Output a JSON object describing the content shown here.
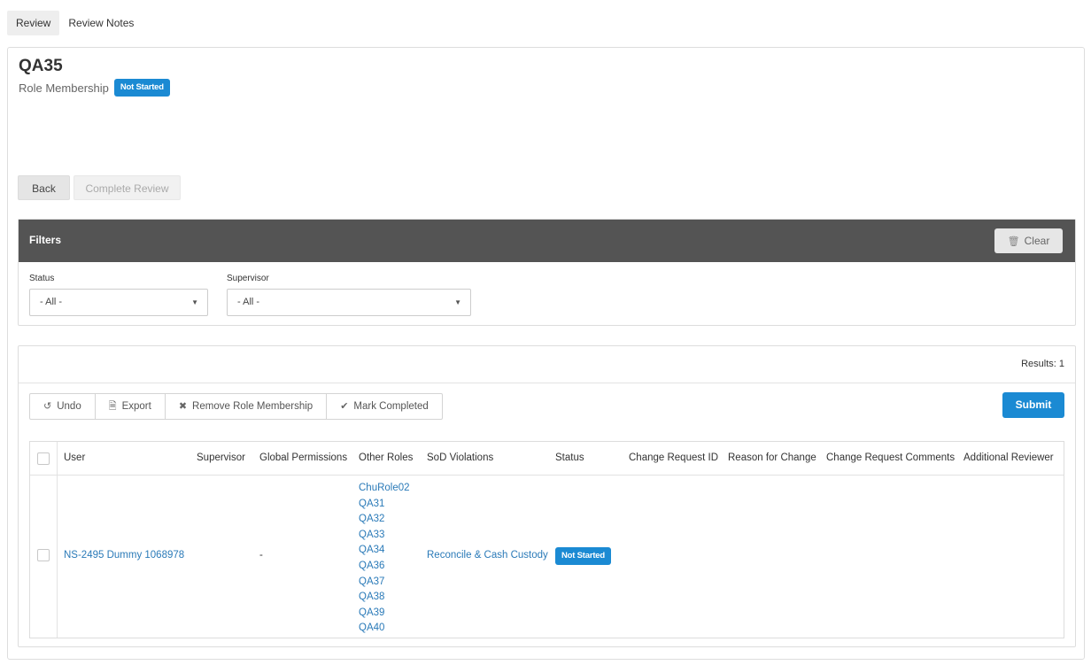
{
  "tabs": [
    {
      "label": "Review",
      "active": true
    },
    {
      "label": "Review Notes",
      "active": false
    }
  ],
  "header": {
    "title": "QA35",
    "subtitle": "Role Membership",
    "status_badge": "Not Started"
  },
  "actions": {
    "back_label": "Back",
    "complete_label": "Complete Review"
  },
  "filters": {
    "title": "Filters",
    "clear_label": "Clear",
    "status": {
      "label": "Status",
      "value": "- All -"
    },
    "supervisor": {
      "label": "Supervisor",
      "value": "- All -"
    }
  },
  "results": {
    "count_label": "Results: 1",
    "toolbar": {
      "undo": "Undo",
      "export": "Export",
      "remove": "Remove Role Membership",
      "mark": "Mark Completed"
    },
    "submit_label": "Submit"
  },
  "table": {
    "columns": [
      "User",
      "Supervisor",
      "Global Permissions",
      "Other Roles",
      "SoD Violations",
      "Status",
      "Change Request ID",
      "Reason for Change",
      "Change Request Comments",
      "Additional Reviewer"
    ],
    "rows": [
      {
        "user": "NS-2495 Dummy 1068978",
        "global_permissions": "-",
        "other_roles": [
          "ChuRole02",
          "QA31",
          "QA32",
          "QA33",
          "QA34",
          "QA36",
          "QA37",
          "QA38",
          "QA39",
          "QA40"
        ],
        "sod_violations": "Reconcile & Cash Custody",
        "status": "Not Started"
      }
    ]
  },
  "colors": {
    "accent": "#1b8ad3",
    "link": "#2a7ab8",
    "filter_header": "#545454"
  },
  "icons": {
    "undo": "undo-icon",
    "export": "file-export-icon",
    "remove": "x-icon",
    "mark": "checkmark-icon",
    "clear": "trash-icon",
    "caret": "caret-down-icon"
  }
}
